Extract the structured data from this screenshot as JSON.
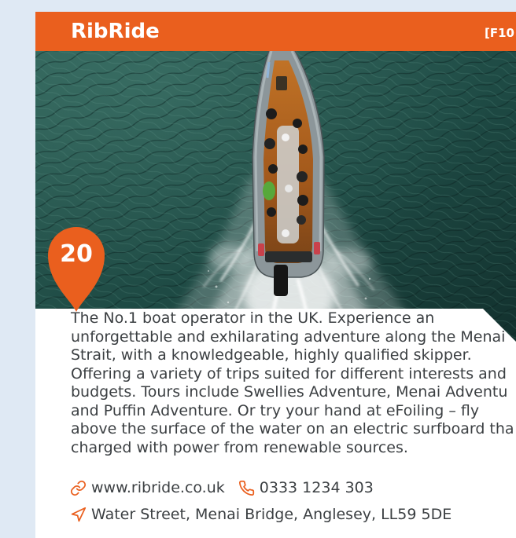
{
  "colors": {
    "accent": "#ea5f1e",
    "text": "#3b3f42",
    "background": "#dfe9f4"
  },
  "header": {
    "title": "RibRide",
    "map_reference": "[F10"
  },
  "pin": {
    "number": "20"
  },
  "description": {
    "lines": [
      "The No.1 boat operator in the UK. Experience an",
      "unforgettable and exhilarating adventure along the Menai",
      "Strait, with a knowledgeable, highly qualified skipper.",
      "Offering a variety of trips suited for different interests and",
      "budgets. Tours include Swellies Adventure, Menai Adventu",
      "and Puffin Adventure. Or try your hand at eFoiling – fly",
      "above the surface of the water on an electric surfboard tha",
      "charged with power from renewable sources."
    ]
  },
  "contact": {
    "website": {
      "icon": "link-icon",
      "text": "www.ribride.co.uk"
    },
    "phone": {
      "icon": "phone-icon",
      "text": "0333 1234 303"
    },
    "address": {
      "icon": "location-arrow-icon",
      "text": "Water Street, Menai Bridge, Anglesey, LL59 5DE"
    }
  }
}
